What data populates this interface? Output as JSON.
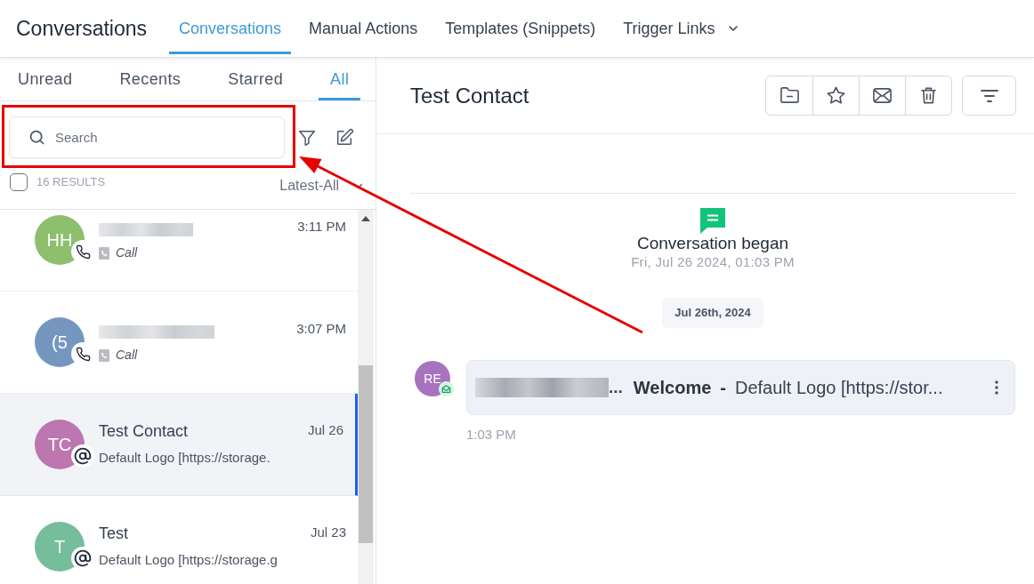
{
  "header": {
    "title": "Conversations",
    "tabs": [
      {
        "label": "Conversations",
        "selected": true,
        "has_menu": false
      },
      {
        "label": "Manual Actions",
        "selected": false,
        "has_menu": false
      },
      {
        "label": "Templates (Snippets)",
        "selected": false,
        "has_menu": false
      },
      {
        "label": "Trigger Links",
        "selected": false,
        "has_menu": true
      }
    ]
  },
  "sidebar": {
    "tabs": [
      {
        "label": "Unread",
        "selected": false
      },
      {
        "label": "Recents",
        "selected": false
      },
      {
        "label": "Starred",
        "selected": false
      },
      {
        "label": "All",
        "selected": true
      }
    ],
    "search": {
      "placeholder": "Search"
    },
    "select_all": {
      "checked": false
    },
    "results": "16 RESULTS",
    "sort": {
      "label": "Latest-All"
    },
    "conversations": [
      {
        "initials": "HH",
        "color": "#8dbf6e",
        "kind": "call",
        "name_redacted": true,
        "preview": "Call",
        "time": "3:11 PM",
        "selected": false
      },
      {
        "initials": "(5",
        "color": "#7597bf",
        "kind": "call",
        "name_redacted": true,
        "preview": "Call",
        "time": "3:07 PM",
        "selected": false
      },
      {
        "initials": "TC",
        "color": "#bd77b0",
        "kind": "email",
        "name_redacted": false,
        "name": "Test Contact",
        "preview": "Default Logo [https://storage.",
        "time": "Jul 26",
        "selected": true
      },
      {
        "initials": "T",
        "color": "#76bd9b",
        "kind": "email",
        "name_redacted": false,
        "name": "Test",
        "preview": "Default Logo [https://storage.g",
        "time": "Jul 23",
        "selected": false
      }
    ]
  },
  "conversation": {
    "title": "Test Contact",
    "began": {
      "label": "Conversation began",
      "time": "Fri, Jul 26 2024, 01:03 PM"
    },
    "date_divider": "Jul 26th, 2024",
    "messages": [
      {
        "initials": "RE",
        "color": "#a773bf",
        "kind": "email",
        "sender_redacted": true,
        "sender": "...",
        "subject": "Welcome",
        "separator": "-",
        "body": "Default Logo [https://stor...",
        "time": "1:03 PM"
      }
    ]
  },
  "annotation": {
    "highlight": true,
    "arrow": true
  }
}
